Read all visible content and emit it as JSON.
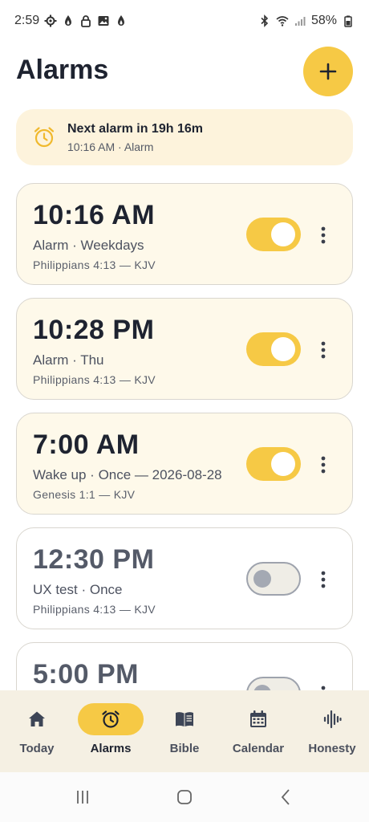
{
  "status_bar": {
    "time": "2:59",
    "battery": "58%",
    "left_icons": [
      "settings-icon",
      "flame-icon",
      "lock-icon",
      "image-icon",
      "flame-icon"
    ],
    "right_icons": [
      "bluetooth-icon",
      "wifi-icon",
      "signal-icon",
      "battery-icon"
    ]
  },
  "header": {
    "title": "Alarms",
    "add_icon": "plus-icon"
  },
  "next_alarm": {
    "title": "Next alarm in 19h 16m",
    "subtitle": "10:16 AM · Alarm",
    "icon": "alarm-clock-icon"
  },
  "alarms": [
    {
      "time": "10:16 AM",
      "label": "Alarm · Weekdays",
      "verse": "Philippians 4:13 — KJV",
      "enabled": true
    },
    {
      "time": "10:28 PM",
      "label": "Alarm · Thu",
      "verse": "Philippians 4:13 — KJV",
      "enabled": true
    },
    {
      "time": "7:00 AM",
      "label": "Wake up · Once — 2026-08-28",
      "verse": "Genesis 1:1 — KJV",
      "enabled": true
    },
    {
      "time": "12:30 PM",
      "label": "UX test · Once",
      "verse": "Philippians 4:13 — KJV",
      "enabled": false
    },
    {
      "time": "5:00 PM",
      "label": "",
      "verse": "",
      "enabled": false
    }
  ],
  "bottom_nav": [
    {
      "label": "Today",
      "icon": "home-icon",
      "active": false
    },
    {
      "label": "Alarms",
      "icon": "alarm-clock-icon",
      "active": true
    },
    {
      "label": "Bible",
      "icon": "book-icon",
      "active": false
    },
    {
      "label": "Calendar",
      "icon": "calendar-icon",
      "active": false
    },
    {
      "label": "Honesty",
      "icon": "waveform-icon",
      "active": false
    }
  ],
  "colors": {
    "accent": "#f6c945",
    "banner_bg": "#fdf3dc",
    "card_on_bg": "#fef9ea",
    "nav_bg": "#f5f0e3"
  }
}
